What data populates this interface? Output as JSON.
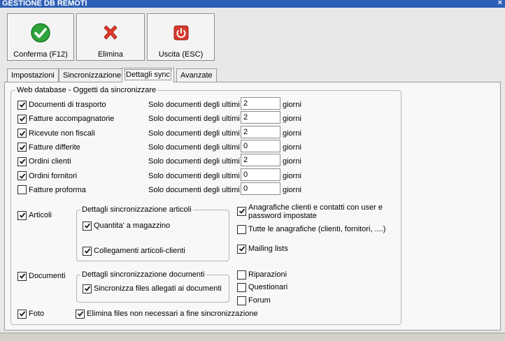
{
  "window": {
    "title": "GESTIONE DB REMOTI",
    "close_glyph": "×"
  },
  "toolbar": {
    "confirm": {
      "label": "Conferma (F12)",
      "icon": "check-icon",
      "color": "#2ea43a"
    },
    "delete": {
      "label": "Elimina",
      "icon": "x-icon",
      "color": "#e23b2a"
    },
    "exit": {
      "label": "Uscita (ESC)",
      "icon": "power-icon",
      "color": "#d63a2f"
    }
  },
  "tabs": [
    {
      "label": "Impostazioni",
      "active": false
    },
    {
      "label": "Sincronizzazione",
      "active": false
    },
    {
      "label": "Dettagli sync",
      "active": true
    },
    {
      "label": "Avanzate",
      "active": false
    }
  ],
  "web_group": {
    "legend": "Web database - Oggetti da sincronizzare",
    "prefix": "Solo documenti degli ultimi",
    "suffix": "giorni",
    "docs": [
      {
        "label": "Documenti di trasporto",
        "checked": true,
        "days": "2"
      },
      {
        "label": "Fatture accompagnatorie",
        "checked": true,
        "days": "2"
      },
      {
        "label": "Ricevute non fiscali",
        "checked": true,
        "days": "2"
      },
      {
        "label": "Fatture differite",
        "checked": true,
        "days": "0"
      },
      {
        "label": "Ordini clienti",
        "checked": true,
        "days": "2"
      },
      {
        "label": "Ordini fornitori",
        "checked": true,
        "days": "0"
      },
      {
        "label": "Fatture proforma",
        "checked": false,
        "days": "0"
      }
    ]
  },
  "articoli": {
    "label": "Articoli",
    "checked": true,
    "group_legend": "Dettagli sincronizzazione articoli",
    "qty": {
      "label": "Quantita' a magazzino",
      "checked": true
    },
    "links": {
      "label": "Collegamenti articoli-clienti",
      "checked": true
    }
  },
  "anagrafiche": {
    "clients": {
      "label_line1": "Anagrafiche clienti e contatti con user e",
      "label_line2": "password impostate",
      "checked": true
    },
    "all": {
      "label": "Tutte le anagrafiche (clienti, fornitori, ....)",
      "checked": false
    },
    "mailing": {
      "label": "Mailing lists",
      "checked": true
    }
  },
  "documenti": {
    "label": "Documenti",
    "checked": true,
    "group_legend": "Dettagli sincronizzazione documenti",
    "attach": {
      "label": "Sincronizza files allegati ai documenti",
      "checked": true
    }
  },
  "extras": {
    "riparazioni": {
      "label": "Riparazioni",
      "checked": false
    },
    "questionari": {
      "label": "Questionari",
      "checked": false
    },
    "forum": {
      "label": "Forum",
      "checked": false
    }
  },
  "foto": {
    "label": "Foto",
    "checked": true
  },
  "cleanup": {
    "label": "Elimina files non necessari a fine sincronizzazione",
    "checked": true
  }
}
